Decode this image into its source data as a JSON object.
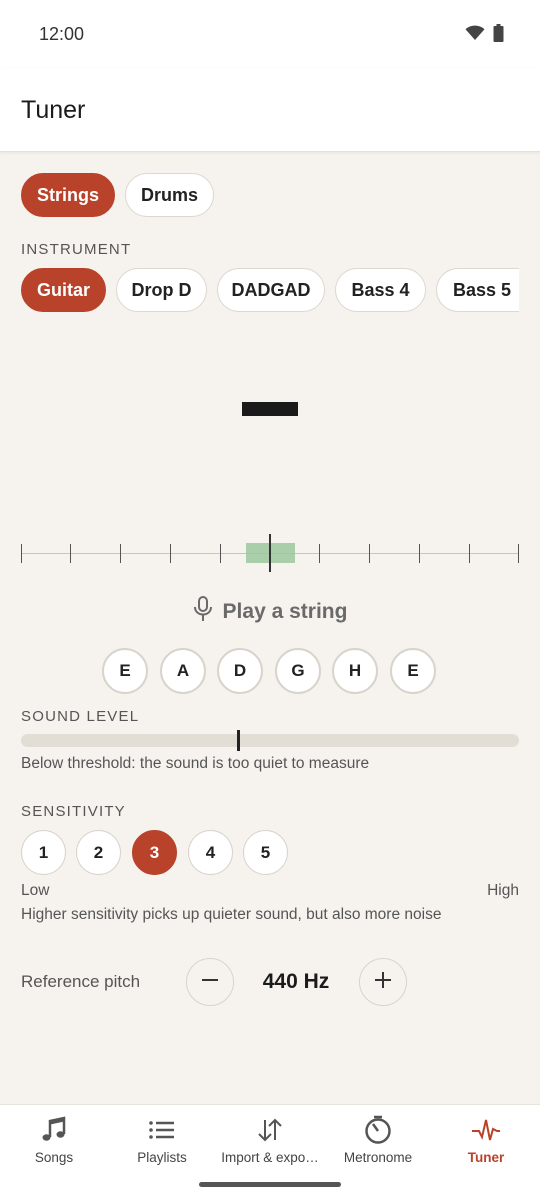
{
  "status": {
    "time": "12:00",
    "icons": [
      "wifi-icon",
      "battery-icon"
    ]
  },
  "app_bar": {
    "title": "Tuner"
  },
  "mode_tabs": [
    {
      "label": "Strings",
      "selected": true
    },
    {
      "label": "Drums",
      "selected": false
    }
  ],
  "instrument": {
    "heading": "INSTRUMENT",
    "options": [
      {
        "label": "Guitar",
        "selected": true
      },
      {
        "label": "Drop D",
        "selected": false
      },
      {
        "label": "DADGAD",
        "selected": false
      },
      {
        "label": "Bass 4",
        "selected": false
      },
      {
        "label": "Bass 5",
        "selected": false
      }
    ]
  },
  "detected_note": "",
  "prompt": {
    "text": "Play a string",
    "icon": "microphone-icon"
  },
  "strings": [
    "E",
    "A",
    "D",
    "G",
    "H",
    "E"
  ],
  "sound_level": {
    "heading": "SOUND LEVEL",
    "threshold_fraction": 0.44,
    "status_text": "Below threshold: the sound is too quiet to measure"
  },
  "sensitivity": {
    "heading": "SENSITIVITY",
    "levels": [
      "1",
      "2",
      "3",
      "4",
      "5"
    ],
    "selected": "3",
    "low_label": "Low",
    "high_label": "High",
    "description": "Higher sensitivity picks up quieter sound, but also more noise"
  },
  "reference_pitch": {
    "label": "Reference pitch",
    "value": "440 Hz",
    "decrement_icon": "minus-icon",
    "increment_icon": "plus-icon"
  },
  "bottom_nav": [
    {
      "label": "Songs",
      "icon": "music-note-icon",
      "active": false
    },
    {
      "label": "Playlists",
      "icon": "list-icon",
      "active": false
    },
    {
      "label": "Import & expo…",
      "icon": "import-export-icon",
      "active": false
    },
    {
      "label": "Metronome",
      "icon": "metronome-icon",
      "active": false
    },
    {
      "label": "Tuner",
      "icon": "pulse-icon",
      "active": true
    }
  ],
  "colors": {
    "accent": "#b9432a",
    "background": "#f6f3ee",
    "in_tune": "#9cc79d"
  }
}
